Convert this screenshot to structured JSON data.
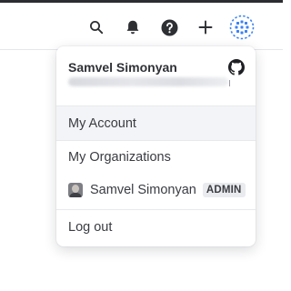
{
  "toolbar": {
    "icons": [
      "search-icon",
      "bell-icon",
      "help-circle-icon",
      "plus-icon",
      "grid-avatar-icon"
    ],
    "accent_color": "#3b82f6"
  },
  "user_menu": {
    "user_name": "Samvel Simonyan",
    "github_icon": "github-icon",
    "items": {
      "my_account": "My Account",
      "my_organizations": "My Organizations",
      "log_out": "Log out"
    },
    "organization": {
      "name": "Samvel Simonyan",
      "role_badge": "ADMIN"
    }
  }
}
